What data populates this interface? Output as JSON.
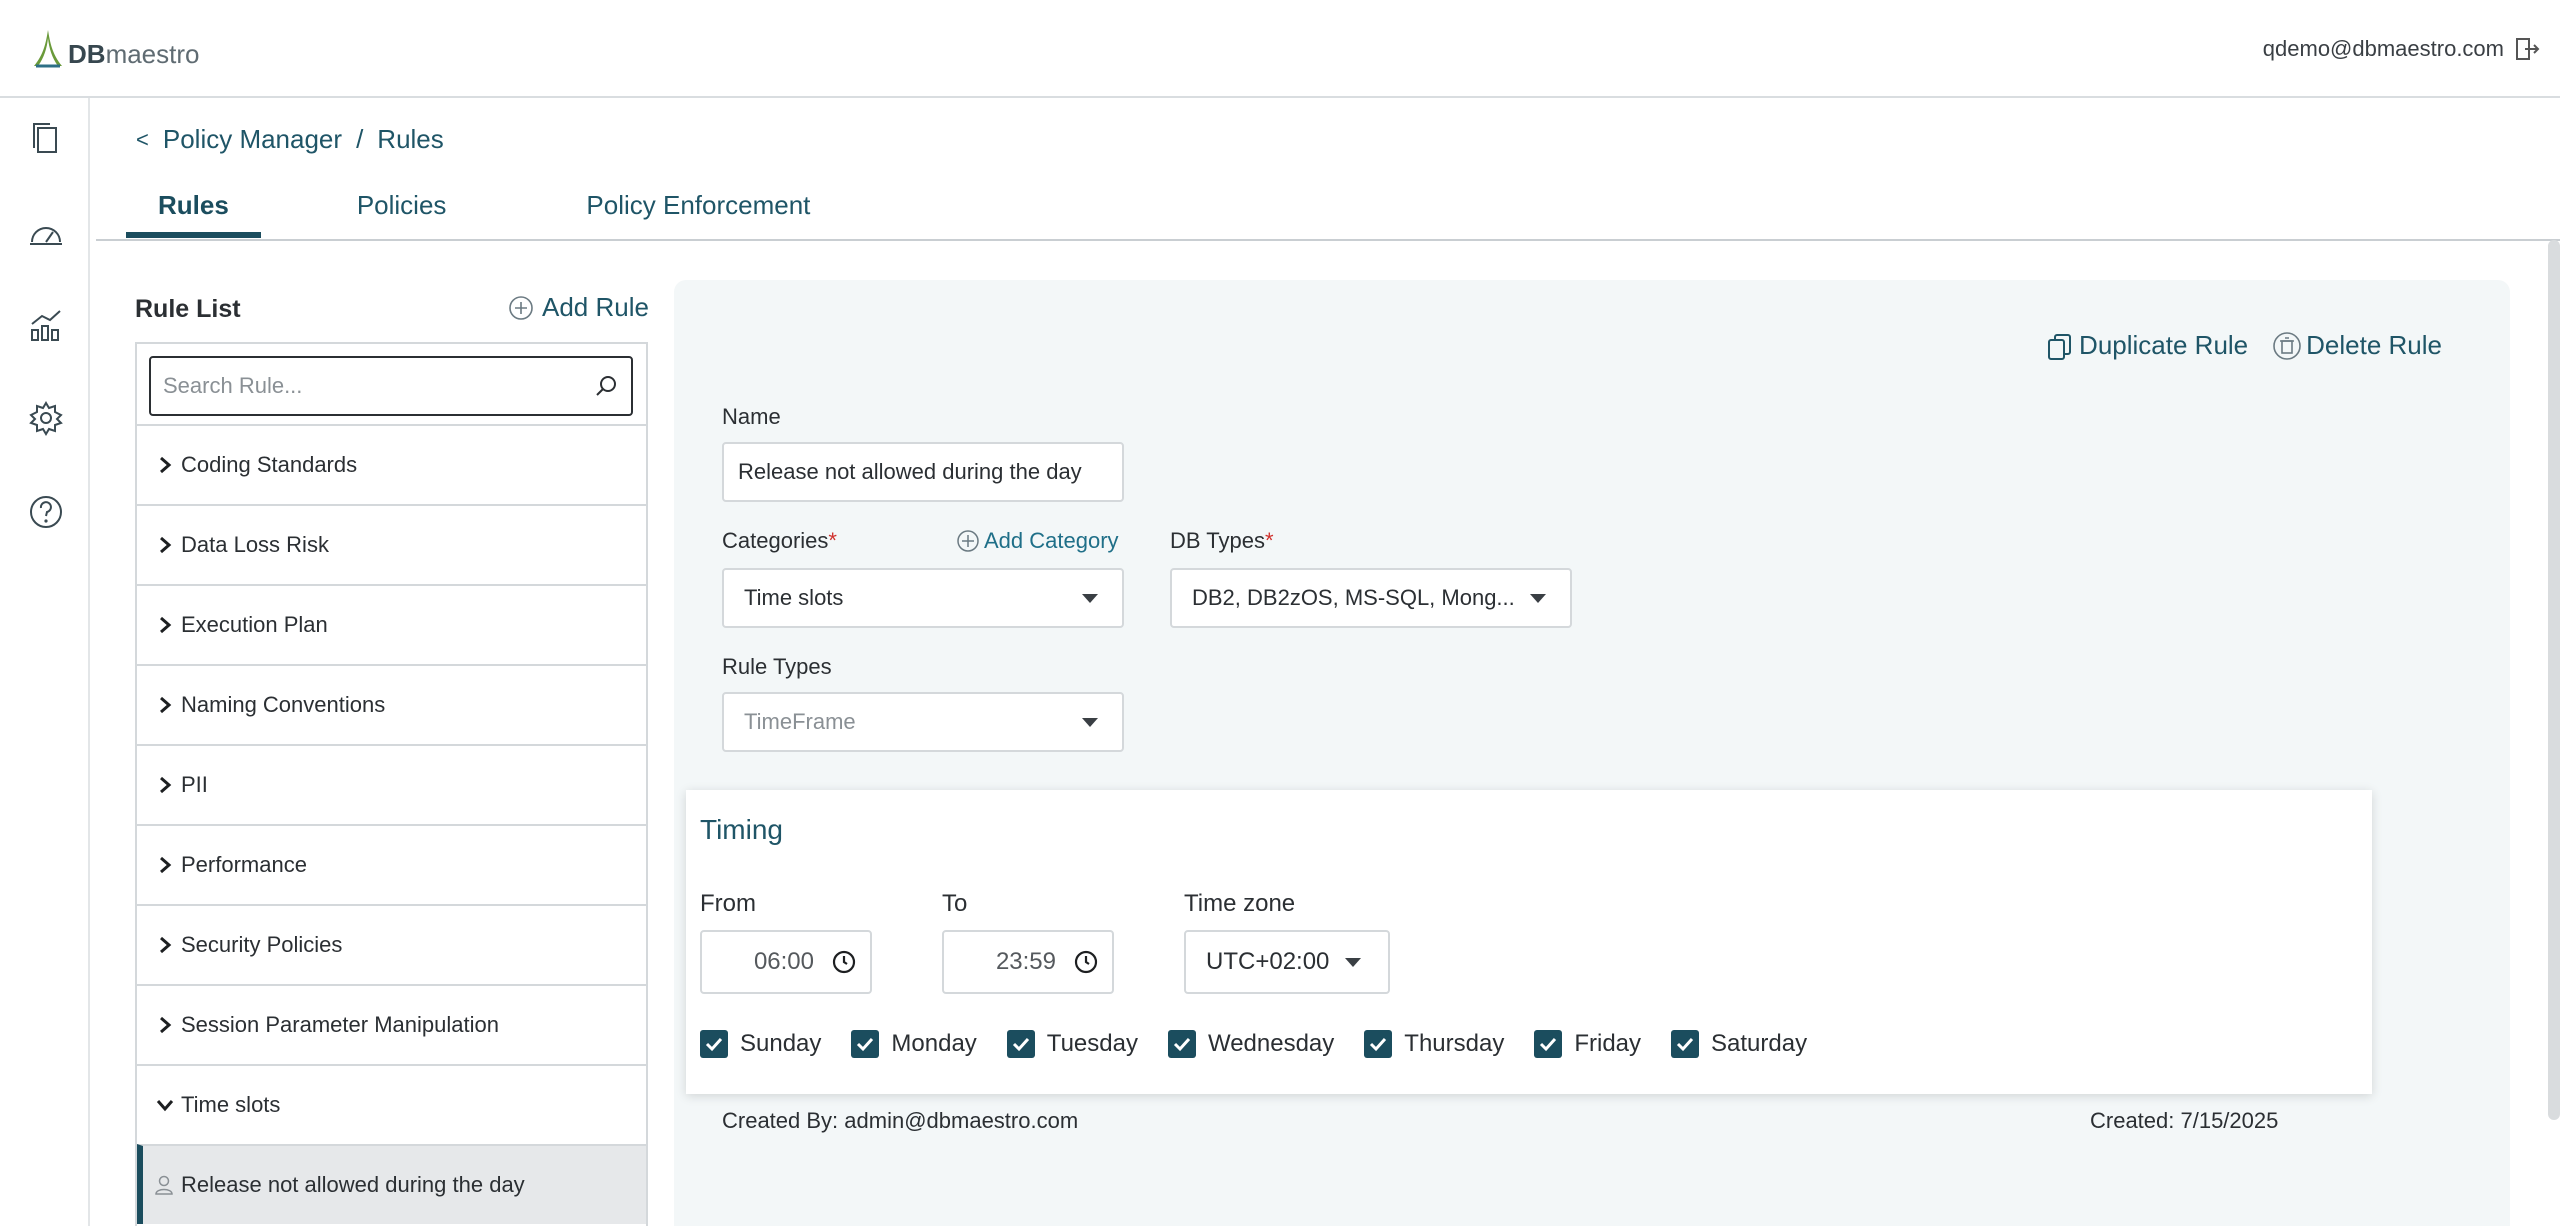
{
  "app": {
    "logo_db": "DB",
    "logo_maestro": "maestro"
  },
  "user": {
    "email": "qdemo@dbmaestro.com"
  },
  "breadcrumb": {
    "back": "<",
    "parent": "Policy Manager",
    "sep": "/",
    "current": "Rules"
  },
  "tabs": [
    {
      "label": "Rules",
      "active": true
    },
    {
      "label": "Policies",
      "active": false
    },
    {
      "label": "Policy Enforcement",
      "active": false
    }
  ],
  "rule_list": {
    "title": "Rule List",
    "add_label": "Add Rule",
    "search_placeholder": "Search Rule...",
    "categories": [
      {
        "label": "Coding Standards",
        "expanded": false
      },
      {
        "label": "Data Loss Risk",
        "expanded": false
      },
      {
        "label": "Execution Plan",
        "expanded": false
      },
      {
        "label": "Naming Conventions",
        "expanded": false
      },
      {
        "label": "PII",
        "expanded": false
      },
      {
        "label": "Performance",
        "expanded": false
      },
      {
        "label": "Security Policies",
        "expanded": false
      },
      {
        "label": "Session Parameter Manipulation",
        "expanded": false
      },
      {
        "label": "Time slots",
        "expanded": true
      }
    ],
    "selected_rule": "Release not allowed during the day"
  },
  "detail": {
    "duplicate_label": "Duplicate Rule",
    "delete_label": "Delete Rule",
    "name_label": "Name",
    "name_value": "Release not allowed during the day",
    "categories_label": "Categories",
    "add_category_label": "Add Category",
    "categories_value": "Time slots",
    "db_types_label": "DB Types",
    "db_types_value": "DB2, DB2zOS, MS-SQL, Mong...",
    "rule_types_label": "Rule Types",
    "rule_types_value": "TimeFrame",
    "required_mark": "*",
    "timing": {
      "title": "Timing",
      "from_label": "From",
      "from_value": "06:00",
      "to_label": "To",
      "to_value": "23:59",
      "timezone_label": "Time zone",
      "timezone_value": "UTC+02:00",
      "days": [
        {
          "label": "Sunday",
          "checked": true
        },
        {
          "label": "Monday",
          "checked": true
        },
        {
          "label": "Tuesday",
          "checked": true
        },
        {
          "label": "Wednesday",
          "checked": true
        },
        {
          "label": "Thursday",
          "checked": true
        },
        {
          "label": "Friday",
          "checked": true
        },
        {
          "label": "Saturday",
          "checked": true
        }
      ]
    },
    "created_by": "Created By: admin@dbmaestro.com",
    "created": "Created: 7/15/2025"
  },
  "colors": {
    "primary": "#1b4d5e",
    "link": "#1f5567",
    "required": "#d0312d",
    "panel_bg": "#f3f7f8"
  }
}
